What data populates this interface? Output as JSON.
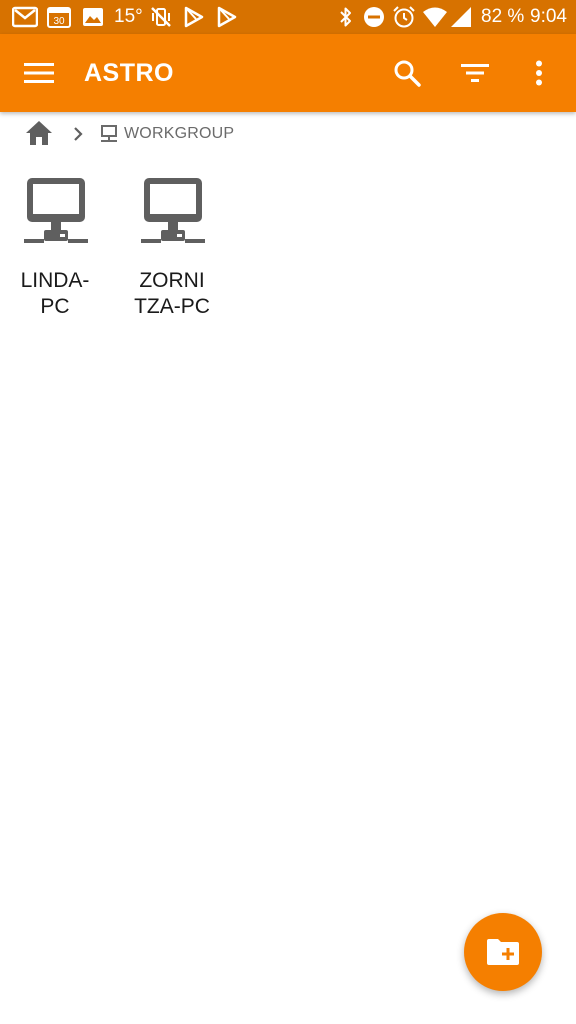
{
  "status_bar": {
    "temperature": "15°",
    "calendar_day": "30",
    "battery": "82 %",
    "time": "9:04",
    "left_icons": [
      "gmail-icon",
      "calendar-icon",
      "photos-icon",
      "temperature-text",
      "vibrate-off-icon",
      "play-store-icon",
      "play-store-icon"
    ],
    "right_icons": [
      "bluetooth-icon",
      "do-not-disturb-icon",
      "alarm-icon",
      "wifi-icon",
      "cell-signal-icon"
    ]
  },
  "toolbar": {
    "title": "ASTRO",
    "menu_icon": "hamburger-menu-icon",
    "actions": [
      "search-icon",
      "filter-icon",
      "more-vert-icon"
    ]
  },
  "breadcrumb": {
    "home_icon": "home-icon",
    "separator_icon": "chevron-right-icon",
    "network_icon": "computer-icon",
    "label": "WORKGROUP"
  },
  "devices": [
    {
      "name": "LINDA-\nPC",
      "icon": "network-computer-icon"
    },
    {
      "name": "ZORNI\nTZA-PC",
      "icon": "network-computer-icon"
    }
  ],
  "fab": {
    "icon": "new-folder-icon"
  },
  "colors": {
    "primary": "#f57f00",
    "status_bar": "#d77200",
    "icon_gray": "#5f5f5f",
    "text_dark": "#1a1a1a"
  }
}
